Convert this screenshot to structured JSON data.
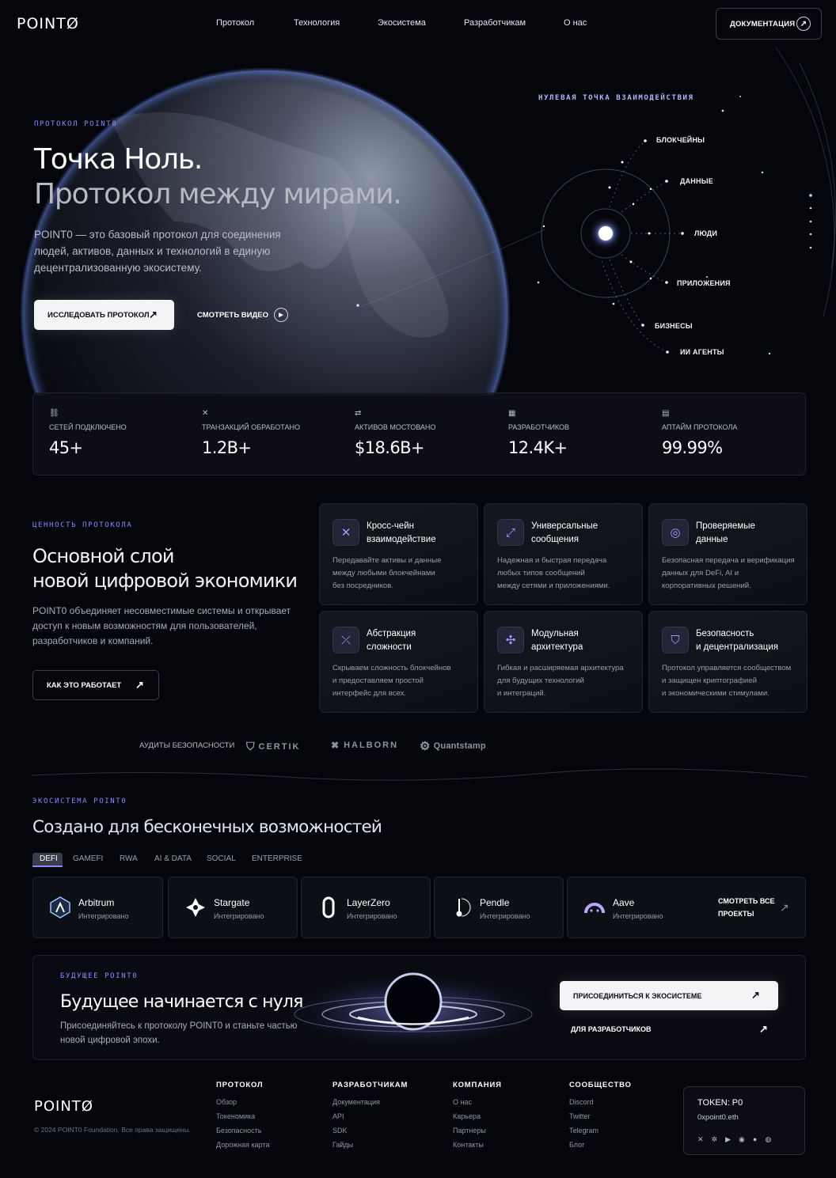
{
  "brand": {
    "logo": "POINTØ",
    "accent": "#8f86ff"
  },
  "nav": {
    "items": [
      "Протокол",
      "Технология",
      "Экосистема",
      "Разработчикам",
      "О нас"
    ],
    "docs_button": "ДОКУМЕНТАЦИЯ"
  },
  "hero": {
    "eyebrow": "ПРОТОКОЛ POINT0",
    "title_line1": "Точка Ноль.",
    "title_line2": "Протокол между мирами.",
    "description": [
      "POINT0 — это базовый протокол для соединения",
      "людей, активов, данных и технологий в единую",
      "децентрализованную экосистему."
    ],
    "primary_button": "ИССЛЕДОВАТЬ ПРОТОКОЛ",
    "secondary_button": "СМОТРЕТЬ ВИДЕО"
  },
  "orbit": {
    "title": "НУЛЕВАЯ ТОЧКА ВЗАИМОДЕЙСТВИЯ",
    "labels": [
      "БЛОКЧЕЙНЫ",
      "ДАННЫЕ",
      "ЛЮДИ",
      "ПРИЛОЖЕНИЯ",
      "БИЗНЕСЫ",
      "ИИ АГЕНТЫ"
    ]
  },
  "stats": [
    {
      "label": "СЕТЕЙ ПОДКЛЮЧЕНО",
      "value": "45+",
      "icon": "network-icon"
    },
    {
      "label": "ТРАНЗАКЦИЙ ОБРАБОТАНО",
      "value": "1.2B+",
      "icon": "transactions-icon"
    },
    {
      "label": "АКТИВОВ МОСТОВАНО",
      "value": "$18.6B+",
      "icon": "bridge-icon"
    },
    {
      "label": "РАЗРАБОТЧИКОВ",
      "value": "12.4K+",
      "icon": "developers-icon"
    },
    {
      "label": "АПТАЙМ ПРОТОКОЛА",
      "value": "99.99%",
      "icon": "uptime-icon"
    }
  ],
  "value": {
    "eyebrow": "ЦЕННОСТЬ ПРОТОКОЛА",
    "title_line1": "Основной слой",
    "title_line2": "новой цифровой экономики",
    "description": [
      "POINT0 объединяет несовместимые системы и открывает",
      "доступ к новым возможностям для пользователей,",
      "разработчиков и компаний."
    ],
    "button": "КАК ЭТО РАБОТАЕТ"
  },
  "features": [
    {
      "title": [
        "Кросс-чейн",
        "взаимодействие"
      ],
      "desc": [
        "Передавайте активы и данные",
        "между любыми блокчейнами",
        "без посредников."
      ],
      "icon": "cross-chain-icon"
    },
    {
      "title": [
        "Универсальные",
        "сообщения"
      ],
      "desc": [
        "Надежная и быстрая передача",
        "любых типов сообщений",
        "между сетями и приложениями."
      ],
      "icon": "messaging-icon"
    },
    {
      "title": [
        "Проверяемые",
        "данные"
      ],
      "desc": [
        "Безопасная передача и верификация",
        "данных для DeFi, AI и",
        "корпоративных решений."
      ],
      "icon": "verified-data-icon"
    },
    {
      "title": [
        "Абстракция",
        "сложности"
      ],
      "desc": [
        "Скрываем сложность блокчейнов",
        "и предоставляем простой",
        "интерфейс для всех."
      ],
      "icon": "abstraction-icon"
    },
    {
      "title": [
        "Модульная",
        "архитектура"
      ],
      "desc": [
        "Гибкая и расширяемая архитектура",
        "для будущих технологий",
        "и интеграций."
      ],
      "icon": "modular-icon"
    },
    {
      "title": [
        "Безопасность",
        "и децентрализация"
      ],
      "desc": [
        "Протокол управляется сообществом",
        "и защищен криптографией",
        "и экономическими стимулами."
      ],
      "icon": "shield-icon"
    }
  ],
  "audits": {
    "label": "АУДИТЫ БЕЗОПАСНОСТИ",
    "brands": [
      "CERTIK",
      "HALBORN",
      "Quantstamp"
    ]
  },
  "ecosystem": {
    "eyebrow": "ЭКОСИСТЕМА POINT0",
    "title": "Создано для бесконечных возможностей",
    "tabs": [
      "DEFI",
      "GAMEFI",
      "RWA",
      "AI & DATA",
      "SOCIAL",
      "ENTERPRISE"
    ],
    "active_tab": "DEFI",
    "projects": [
      {
        "name": "Arbitrum",
        "status": "Интегрировано"
      },
      {
        "name": "Stargate",
        "status": "Интегрировано"
      },
      {
        "name": "LayerZero",
        "status": "Интегрировано"
      },
      {
        "name": "Pendle",
        "status": "Интегрировано"
      },
      {
        "name": "Aave",
        "status": "Интегрировано"
      }
    ],
    "view_all": [
      "СМОТРЕТЬ ВСЕ",
      "ПРОЕКТЫ"
    ]
  },
  "cta": {
    "eyebrow": "БУДУЩЕЕ POINT0",
    "title": "Будущее начинается с нуля",
    "description": [
      "Присоединяйтесь к протоколу POINT0 и станьте частью",
      "новой цифровой эпохи."
    ],
    "primary_button": "ПРИСОЕДИНИТЬСЯ К ЭКОСИСТЕМЕ",
    "secondary_button": "ДЛЯ РАЗРАБОТЧИКОВ"
  },
  "footer": {
    "logo": "POINTØ",
    "copyright": "© 2024 POINT0 Foundation. Все права защищены.",
    "columns": [
      {
        "title": "ПРОТОКОЛ",
        "links": [
          "Обзор",
          "Токеномика",
          "Безопасность",
          "Дорожная карта"
        ]
      },
      {
        "title": "РАЗРАБОТЧИКАМ",
        "links": [
          "Документация",
          "API",
          "SDK",
          "Гайды"
        ]
      },
      {
        "title": "КОМПАНИЯ",
        "links": [
          "О нас",
          "Карьера",
          "Партнеры",
          "Контакты"
        ]
      },
      {
        "title": "СООБЩЕСТВО",
        "links": [
          "Discord",
          "Twitter",
          "Telegram",
          "Блог"
        ]
      }
    ],
    "token": {
      "label": "TOKEN: P0",
      "address": "0xpoint0.eth"
    },
    "socials": [
      "x-icon",
      "butterfly-icon",
      "youtube-icon",
      "discord-icon",
      "github-icon",
      "medium-icon"
    ]
  }
}
